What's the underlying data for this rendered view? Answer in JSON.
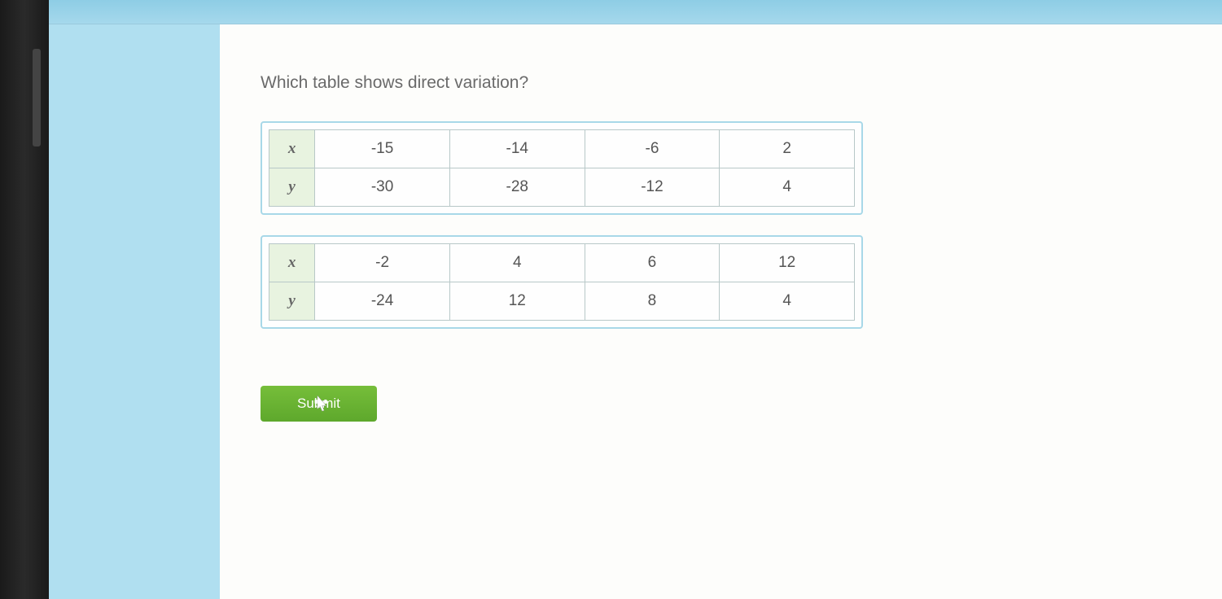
{
  "question": "Which table shows direct variation?",
  "tables": [
    {
      "rows": [
        {
          "label": "x",
          "values": [
            "-15",
            "-14",
            "-6",
            "2"
          ]
        },
        {
          "label": "y",
          "values": [
            "-30",
            "-28",
            "-12",
            "4"
          ]
        }
      ]
    },
    {
      "rows": [
        {
          "label": "x",
          "values": [
            "-2",
            "4",
            "6",
            "12"
          ]
        },
        {
          "label": "y",
          "values": [
            "-24",
            "12",
            "8",
            "4"
          ]
        }
      ]
    }
  ],
  "submit_label": "Submit"
}
